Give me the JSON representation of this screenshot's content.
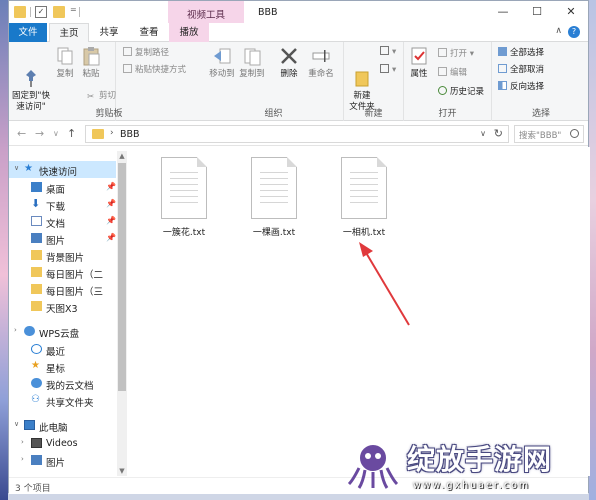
{
  "titlebar": {
    "context_tab": "视频工具",
    "title": "BBB",
    "min": "—",
    "max": "☐",
    "close": "✕"
  },
  "tabs": {
    "file": "文件",
    "home": "主页",
    "share": "共享",
    "view": "查看",
    "play": "播放"
  },
  "ribbon": {
    "clipboard": {
      "label": "剪贴板",
      "pin": "固定到\"快\n速访问\"",
      "copy": "复制",
      "paste": "粘贴",
      "copy_path": "复制路径",
      "paste_shortcut": "粘贴快捷方式",
      "cut": "剪切"
    },
    "organize": {
      "label": "组织",
      "move_to": "移动到",
      "copy_to": "复制到",
      "delete": "删除",
      "rename": "重命名"
    },
    "new": {
      "label": "新建",
      "new_folder": "新建\n文件夹"
    },
    "open": {
      "label": "打开",
      "properties": "属性",
      "open": "打开",
      "edit": "编辑",
      "history": "历史记录"
    },
    "select": {
      "label": "选择",
      "select_all": "全部选择",
      "select_none": "全部取消",
      "invert": "反向选择"
    }
  },
  "address": {
    "path": "BBB",
    "search_placeholder": "搜索\"BBB\""
  },
  "nav": {
    "items": [
      {
        "label": "快速访问",
        "icon": "star-icon",
        "pinned": false
      },
      {
        "label": "桌面",
        "icon": "desktop-icon",
        "pinned": true
      },
      {
        "label": "下载",
        "icon": "download-icon",
        "pinned": true
      },
      {
        "label": "文档",
        "icon": "document-icon",
        "pinned": true
      },
      {
        "label": "图片",
        "icon": "pictures-icon",
        "pinned": true
      },
      {
        "label": "背景图片",
        "icon": "folder-icon",
        "pinned": false
      },
      {
        "label": "每日图片（二",
        "icon": "folder-icon",
        "pinned": false
      },
      {
        "label": "每日图片（三",
        "icon": "folder-icon",
        "pinned": false
      },
      {
        "label": "天图X3",
        "icon": "folder-icon",
        "pinned": false
      },
      {
        "label": "WPS云盘",
        "icon": "cloud-icon",
        "pinned": false
      },
      {
        "label": "最近",
        "icon": "clock-icon",
        "pinned": false
      },
      {
        "label": "星标",
        "icon": "star-icon",
        "pinned": false
      },
      {
        "label": "我的云文档",
        "icon": "cloud-icon",
        "pinned": false
      },
      {
        "label": "共享文件夹",
        "icon": "share-icon",
        "pinned": false
      },
      {
        "label": "此电脑",
        "icon": "computer-icon",
        "pinned": false
      },
      {
        "label": "Videos",
        "icon": "video-icon",
        "pinned": false
      },
      {
        "label": "图片",
        "icon": "pictures-icon",
        "pinned": false
      }
    ]
  },
  "files": [
    {
      "name": "一簇花.txt"
    },
    {
      "name": "一棵画.txt"
    },
    {
      "name": "一相机.txt"
    }
  ],
  "status": {
    "count": "3 个项目"
  },
  "watermark": {
    "title": "绽放手游网",
    "url": "www.gxhuaer.com"
  },
  "colors": {
    "accent": "#1979ca",
    "context_tab": "#f6d5e9",
    "selection": "#cce8ff",
    "arrow": "#e0393c"
  }
}
